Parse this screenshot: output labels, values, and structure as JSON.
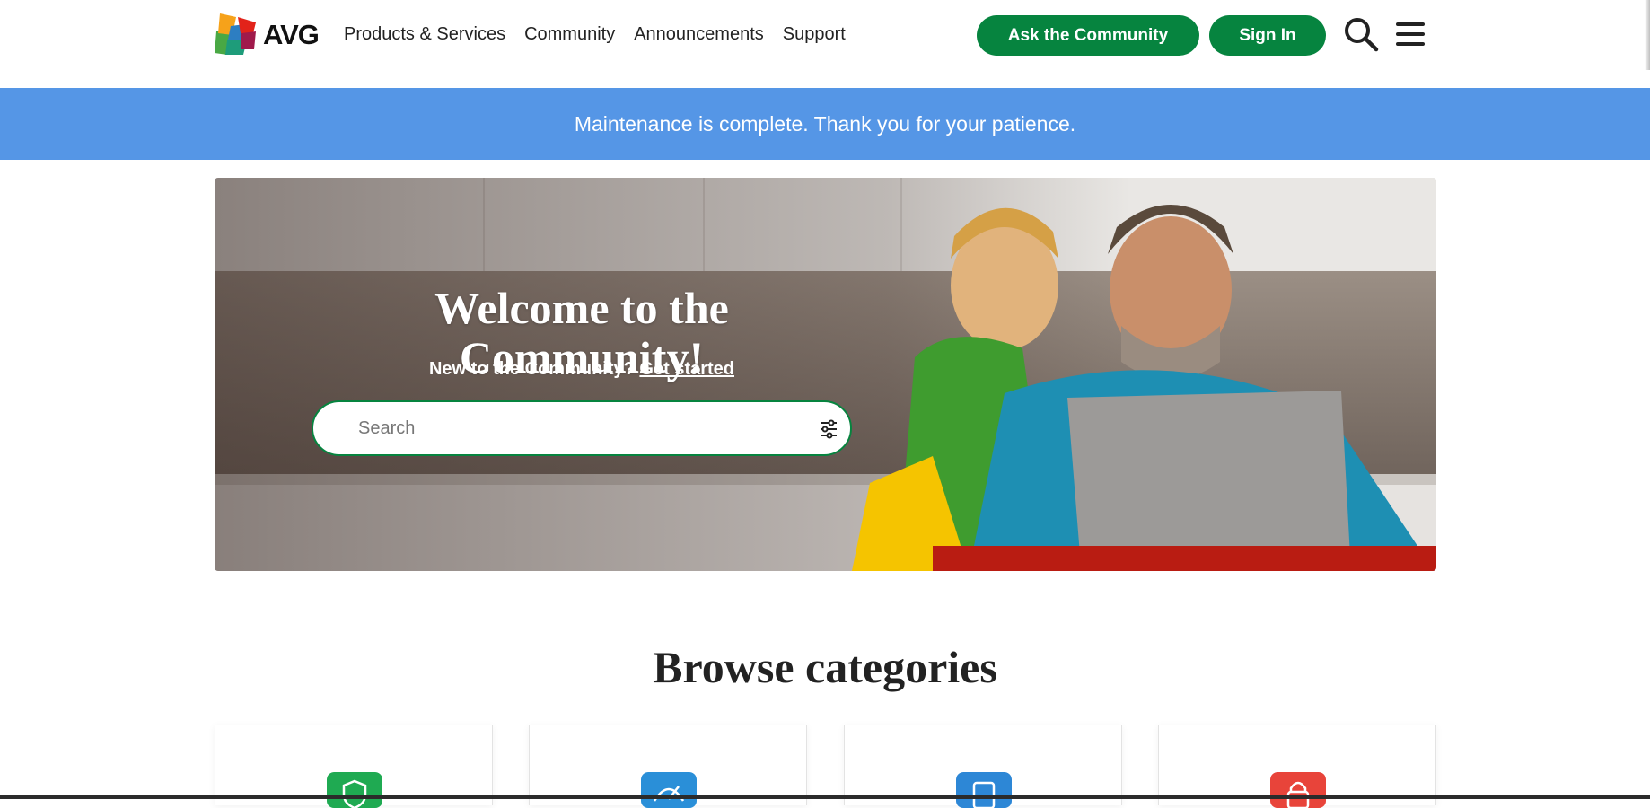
{
  "brand": {
    "name": "AVG"
  },
  "nav": {
    "items": [
      "Products & Services",
      "Community",
      "Announcements",
      "Support"
    ]
  },
  "header": {
    "ask_button": "Ask the Community",
    "signin_button": "Sign In",
    "search_icon": "search-icon",
    "menu_icon": "hamburger-menu-icon"
  },
  "banner": {
    "text": "Maintenance is complete. Thank you for your patience."
  },
  "hero": {
    "title": "Welcome to the Community!",
    "new_prefix": "New to the Community?",
    "get_started": "Get started",
    "search_placeholder": "Search"
  },
  "browse": {
    "title": "Browse categories",
    "cards": [
      {
        "icon": "shield-icon",
        "color": "#1faa52"
      },
      {
        "icon": "speedometer-icon",
        "color": "#2a8fd8"
      },
      {
        "icon": "device-icon",
        "color": "#2d87d6"
      },
      {
        "icon": "lock-icon",
        "color": "#e8443a"
      }
    ]
  },
  "colors": {
    "primary_green": "#06843f",
    "banner_blue": "#5596e6"
  }
}
